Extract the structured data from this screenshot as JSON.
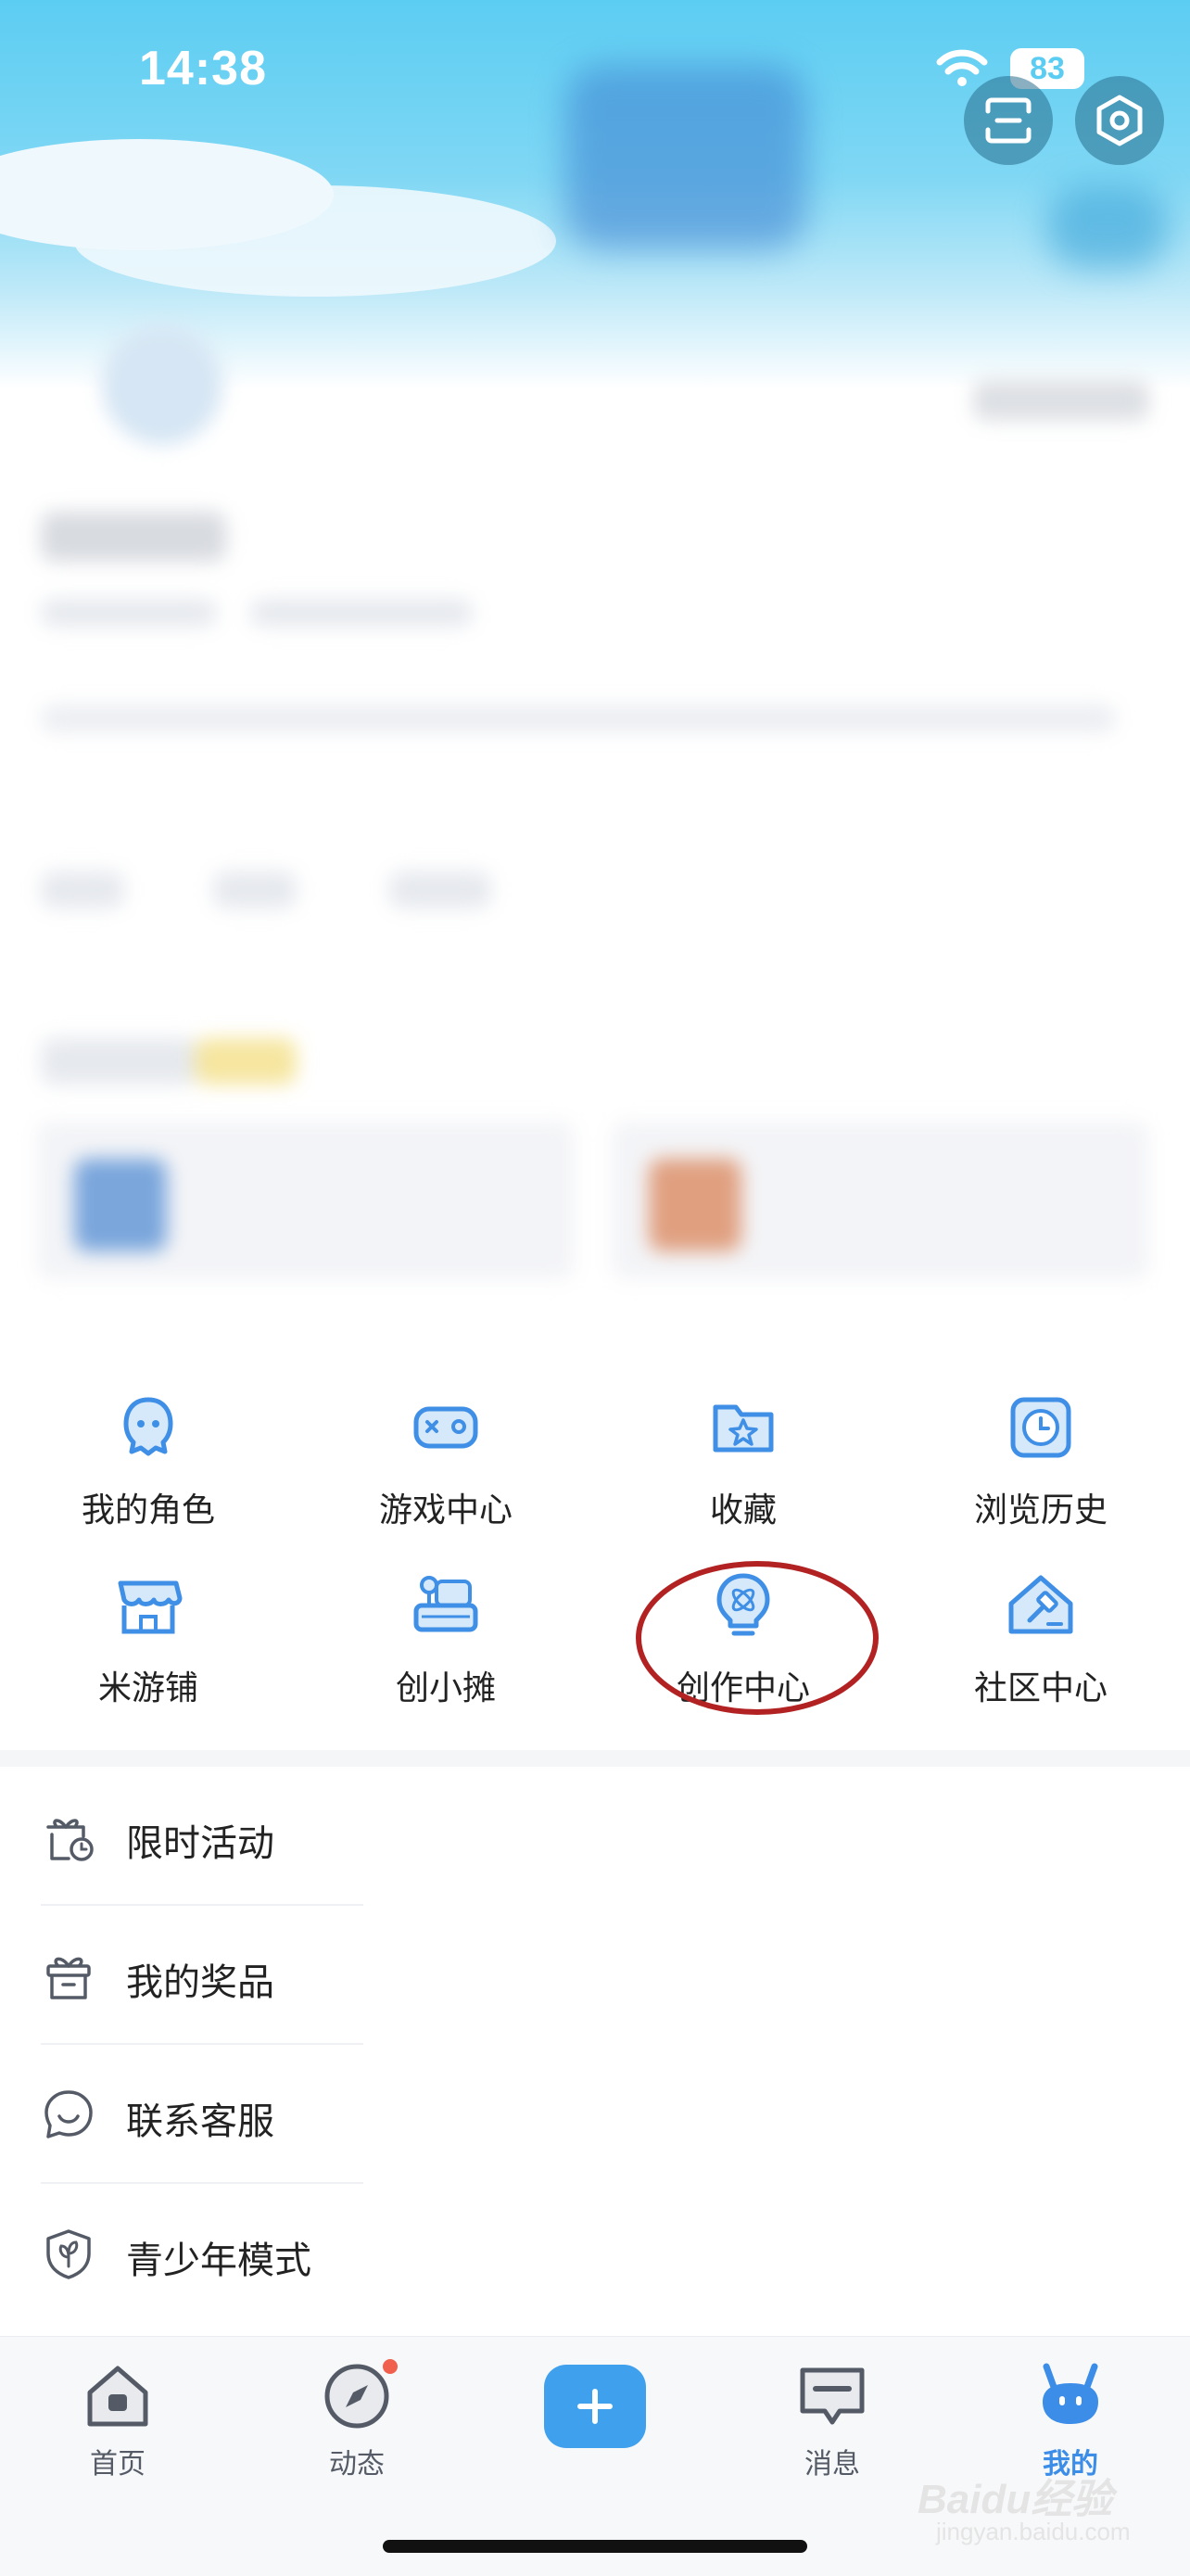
{
  "status_bar": {
    "time": "14:38",
    "battery": "83"
  },
  "header": {
    "scan_icon": "scan-icon",
    "settings_icon": "settings-hex-icon"
  },
  "grid": [
    {
      "label": "我的角色",
      "icon": "character-icon"
    },
    {
      "label": "游戏中心",
      "icon": "gamepad-icon"
    },
    {
      "label": "收藏",
      "icon": "folder-star-icon"
    },
    {
      "label": "浏览历史",
      "icon": "clock-icon"
    },
    {
      "label": "米游铺",
      "icon": "store-icon"
    },
    {
      "label": "创小摊",
      "icon": "stall-icon"
    },
    {
      "label": "创作中心",
      "icon": "creation-bulb-icon"
    },
    {
      "label": "社区中心",
      "icon": "community-house-icon"
    }
  ],
  "list": [
    {
      "label": "限时活动",
      "icon": "gift-clock-icon"
    },
    {
      "label": "我的奖品",
      "icon": "gift-box-icon"
    },
    {
      "label": "联系客服",
      "icon": "chat-smile-icon"
    },
    {
      "label": "青少年模式",
      "icon": "shield-leaf-icon"
    }
  ],
  "tabs": [
    {
      "label": "首页",
      "icon": "home-icon",
      "active": false
    },
    {
      "label": "动态",
      "icon": "compass-icon",
      "active": false,
      "badge_dot": true
    },
    {
      "label": "",
      "icon": "plus-icon"
    },
    {
      "label": "消息",
      "icon": "message-icon",
      "active": false
    },
    {
      "label": "我的",
      "icon": "bunny-ears-icon",
      "active": true
    }
  ],
  "colors": {
    "accent": "#3b8de8",
    "icon_blue": "#3f8fe6",
    "annotation": "#b22222"
  },
  "watermark": {
    "brand": "Baidu经验",
    "url": "jingyan.baidu.com"
  }
}
